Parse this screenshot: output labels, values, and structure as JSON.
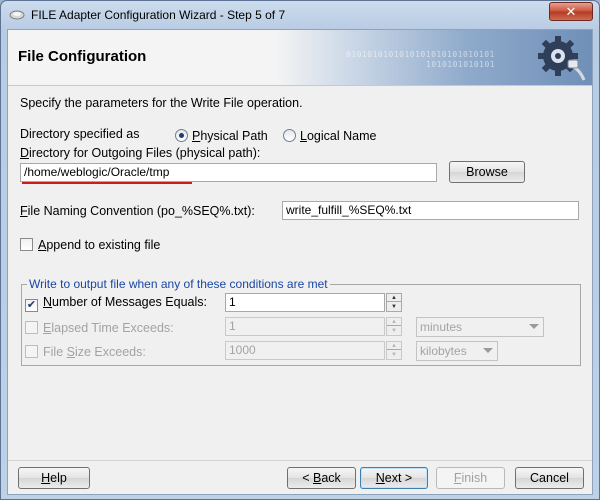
{
  "window": {
    "title": "FILE Adapter Configuration Wizard - Step 5 of 7",
    "close_glyph": "✕"
  },
  "header": {
    "title": "File Configuration",
    "binary_line1": "0101010101010101010101010101",
    "binary_line2": "1010101010101"
  },
  "intro": "Specify the parameters for the Write File operation.",
  "directory_spec": {
    "label": "Directory specified as",
    "options": [
      {
        "label_pre": "",
        "mnemonic": "P",
        "label_post": "hysical Path",
        "checked": true
      },
      {
        "label_pre": "",
        "mnemonic": "L",
        "label_post": "ogical Name",
        "checked": false
      }
    ]
  },
  "outgoing": {
    "label_pre": "",
    "mnemonic": "D",
    "label_post": "irectory for Outgoing Files (physical path):",
    "value": "/home/weblogic/Oracle/tmp",
    "browse_label": "Browse",
    "browse_mnemonic": "r"
  },
  "naming": {
    "label_pre": "",
    "mnemonic": "F",
    "label_post": "ile Naming Convention (po_%SEQ%.txt):",
    "value": "write_fulfill_%SEQ%.txt"
  },
  "append": {
    "label_pre": "",
    "mnemonic": "A",
    "label_post": "ppend to existing file",
    "checked": false
  },
  "conditions": {
    "legend": "Write to output file when any of these conditions are met",
    "rows": [
      {
        "label_pre": "",
        "mnemonic": "N",
        "label_post": "umber of Messages Equals:",
        "checked": true,
        "value": "1",
        "enabled": true
      },
      {
        "label_pre": "",
        "mnemonic": "E",
        "label_post": "lapsed Time Exceeds:",
        "checked": false,
        "value": "1",
        "enabled": false,
        "unit": "minutes"
      },
      {
        "label_pre": "File ",
        "mnemonic": "S",
        "label_post": "ize Exceeds:",
        "checked": false,
        "value": "1000",
        "enabled": false,
        "unit": "kilobytes"
      }
    ]
  },
  "buttons": {
    "help": {
      "mnemonic": "H",
      "rest": "elp"
    },
    "back": {
      "prefix": "< ",
      "mnemonic": "B",
      "rest": "ack"
    },
    "next": {
      "mnemonic": "N",
      "rest": "ext >"
    },
    "finish": {
      "mnemonic": "F",
      "rest": "inish"
    },
    "cancel": "Cancel"
  },
  "colors": {
    "legend": "#1a46a6",
    "underline_annotation": "#cc1c1c",
    "window_frame": "#b7cbe3"
  }
}
